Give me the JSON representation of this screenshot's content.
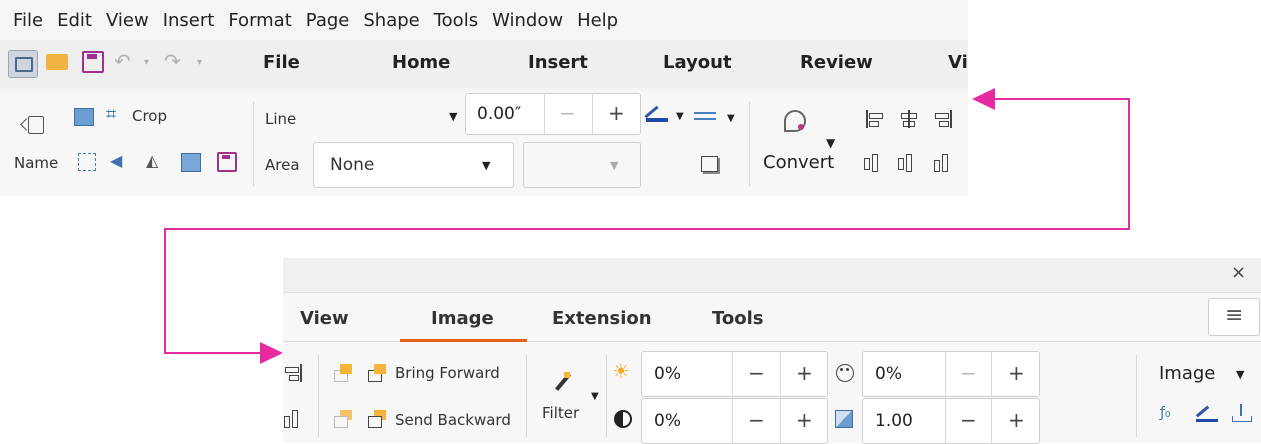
{
  "menu": [
    "File",
    "Edit",
    "View",
    "Insert",
    "Format",
    "Page",
    "Shape",
    "Tools",
    "Window",
    "Help"
  ],
  "top_tabs": [
    "File",
    "Home",
    "Insert",
    "Layout",
    "Review",
    "Vi"
  ],
  "toolbar1": {
    "crop": "Crop",
    "name": "Name",
    "line_label": "Line",
    "area_label": "Area",
    "line_width": "0.00″",
    "area_fill": "None",
    "convert": "Convert",
    "minus": "−",
    "plus": "+"
  },
  "bottom": {
    "close": "×",
    "tabs": [
      "View",
      "Image",
      "Extension",
      "Tools"
    ],
    "active_tab": "Image",
    "bring_forward": "Bring Forward",
    "send_backward": "Send Backward",
    "filter": "Filter",
    "brightness": "0%",
    "contrast": "0%",
    "transparency": "0%",
    "gamma": "1.00",
    "image_menu": "Image",
    "minus": "−",
    "plus": "+",
    "hamburger": "≡"
  },
  "colors": {
    "accent_orange": "#e8641e",
    "arrow_pink": "#e62ba0",
    "save_purple": "#a0308c"
  }
}
